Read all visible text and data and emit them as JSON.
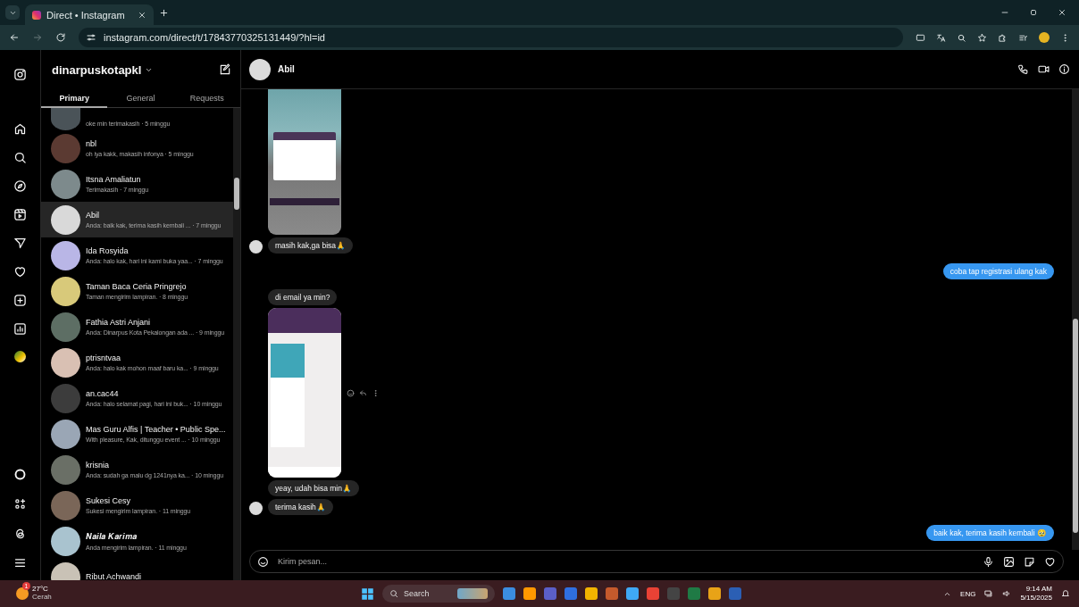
{
  "browser": {
    "tab_title": "Direct • Instagram",
    "url": "instagram.com/direct/t/17843770325131449/?hl=id"
  },
  "inbox": {
    "username": "dinarpuskotapkl",
    "tabs": [
      {
        "label": "Primary",
        "selected": true
      },
      {
        "label": "General",
        "selected": false
      },
      {
        "label": "Requests",
        "selected": false
      }
    ],
    "conversations": [
      {
        "preview": "oke min terimakasih · 5 minggu",
        "selected": false
      },
      {
        "name": "nbl",
        "preview": "oh iya kakk, makasih infonya · 5 minggu",
        "selected": false
      },
      {
        "name": "Itsna Amaliatun",
        "preview": "Terimakasih · 7 minggu",
        "selected": false
      },
      {
        "name": "Abil",
        "preview": "Anda: baik kak, terima kasih kembali ... · 7 minggu",
        "selected": true
      },
      {
        "name": "Ida Rosyida",
        "preview": "Anda: halo kak, hari ini kami buka yaa... · 7 minggu",
        "selected": false
      },
      {
        "name": "Taman Baca Ceria Pringrejo",
        "preview": "Taman mengirim lampiran. · 8 minggu",
        "selected": false
      },
      {
        "name": "Fathia Astri Anjani",
        "preview": "Anda: Dinarpus Kota Pekalongan ada ... · 9 minggu",
        "selected": false
      },
      {
        "name": "ptrisntvaa",
        "preview": "Anda: halo kak mohon maaf baru ka... · 9 minggu",
        "selected": false
      },
      {
        "name": "an.cac44",
        "preview": "Anda: halo selamat pagi, hari ini buk... · 10 minggu",
        "selected": false
      },
      {
        "name": "Mas Guru Alfis | Teacher • Public Spe...",
        "preview": "With pleasure, Kak, ditunggu event ... · 10 minggu",
        "selected": false
      },
      {
        "name": "krisnia",
        "preview": "Anda: sudah ga malu dg 1241nya ka... · 10 minggu",
        "selected": false
      },
      {
        "name": "Sukesi Cesy",
        "preview": "Sukesi mengirim lampiran. · 11 minggu",
        "selected": false
      },
      {
        "name": "𝑵𝒂𝒊𝒍𝒂 𝑲𝒂𝒓𝒊𝒎𝒂",
        "preview": "Anda mengirim lampiran. · 11 minggu",
        "selected": false
      },
      {
        "name": "Ribut Achwandi",
        "selected": false
      }
    ]
  },
  "chat": {
    "name": "Abil",
    "messages": [
      {
        "kind": "image",
        "outgoing": false
      },
      {
        "kind": "text",
        "outgoing": false,
        "text": "masih kak,ga bisa🙏"
      },
      {
        "kind": "text",
        "outgoing": true,
        "text": "coba tap registrasi ulang kak"
      },
      {
        "kind": "text",
        "outgoing": false,
        "text": "di email ya min?"
      },
      {
        "kind": "image",
        "outgoing": false,
        "hover_actions": true
      },
      {
        "kind": "text",
        "outgoing": false,
        "text": "yeay, udah bisa min🙏"
      },
      {
        "kind": "text",
        "outgoing": false,
        "text": "terima kasih🙏"
      },
      {
        "kind": "text",
        "outgoing": true,
        "text": "baik kak, terima kasih kembali 🥹"
      }
    ],
    "composer": {
      "placeholder": "Kirim pesan..."
    }
  },
  "taskbar": {
    "weather": {
      "badge": "1",
      "temp": "27°C",
      "condition": "Cerah"
    },
    "search": {
      "placeholder": "Search"
    },
    "language": "ENG",
    "time": "9:14 AM",
    "date": "5/15/2025"
  }
}
